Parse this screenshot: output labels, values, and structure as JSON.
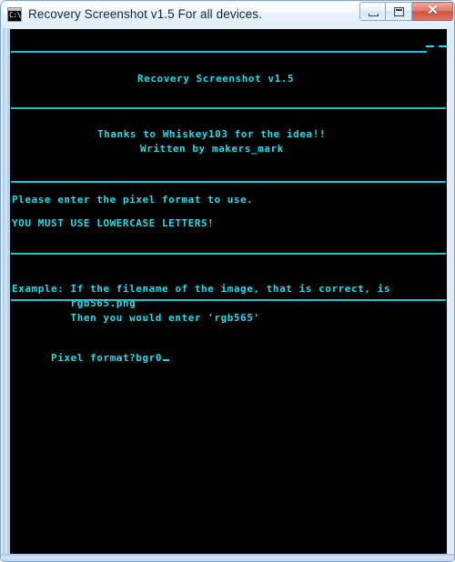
{
  "window": {
    "title": "Recovery Screenshot v1.5 For all devices.",
    "icon_name": "console-cmd-icon",
    "icon_text": "C:\\",
    "buttons": {
      "minimize_label": "",
      "restore_label": "",
      "close_label": "✕"
    }
  },
  "console": {
    "background_color": "#000000",
    "text_color": "#24dcea",
    "rule_color": "#16c8d2",
    "banner_title": "Recovery Screenshot v1.5",
    "thanks_line": "Thanks to Whiskey103 for the idea!!",
    "author_line": "Written by makers_mark",
    "instruction_line": "Please enter the pixel format to use.",
    "warning_line": "YOU MUST USE LOWERCASE LETTERS!",
    "example_line_1": "Example: If the filename of the image, that is correct, is",
    "example_line_2": "         rgb565.png",
    "example_line_3": "         Then you would enter 'rgb565'",
    "prompt_label": "Pixel format?",
    "prompt_value": "bgr0"
  }
}
